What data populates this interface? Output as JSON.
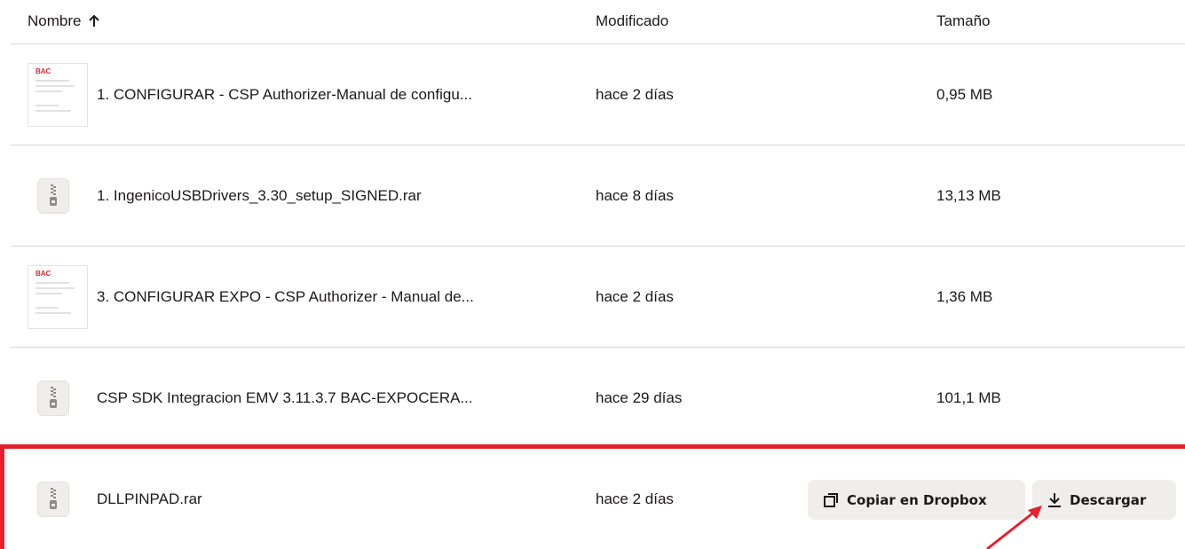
{
  "header": {
    "name_label": "Nombre",
    "modified_label": "Modificado",
    "size_label": "Tamaño"
  },
  "files": [
    {
      "name": "1. CONFIGURAR - CSP Authorizer-Manual de configu...",
      "modified": "hace 2 días",
      "size": "0,95 MB",
      "icon": "pdf-thumbnail",
      "thumb_logo": "BAC"
    },
    {
      "name": "1. IngenicoUSBDrivers_3.30_setup_SIGNED.rar",
      "modified": "hace 8 días",
      "size": "13,13 MB",
      "icon": "zip-icon"
    },
    {
      "name": "3. CONFIGURAR EXPO - CSP Authorizer - Manual de...",
      "modified": "hace 2 días",
      "size": "1,36 MB",
      "icon": "pdf-thumbnail",
      "thumb_logo": "BAC"
    },
    {
      "name": "CSP SDK Integracion EMV 3.11.3.7 BAC-EXPOCERA...",
      "modified": "hace 29 días",
      "size": "101,1 MB",
      "icon": "zip-icon"
    },
    {
      "name": "DLLPINPAD.rar",
      "modified": "hace 2 días",
      "icon": "zip-icon"
    }
  ],
  "actions": {
    "copy_label": "Copiar en Dropbox",
    "download_label": "Descargar"
  },
  "colors": {
    "highlight": "#e5222b",
    "button_bg": "#f0eeeb",
    "divider": "#dcd9d6"
  }
}
